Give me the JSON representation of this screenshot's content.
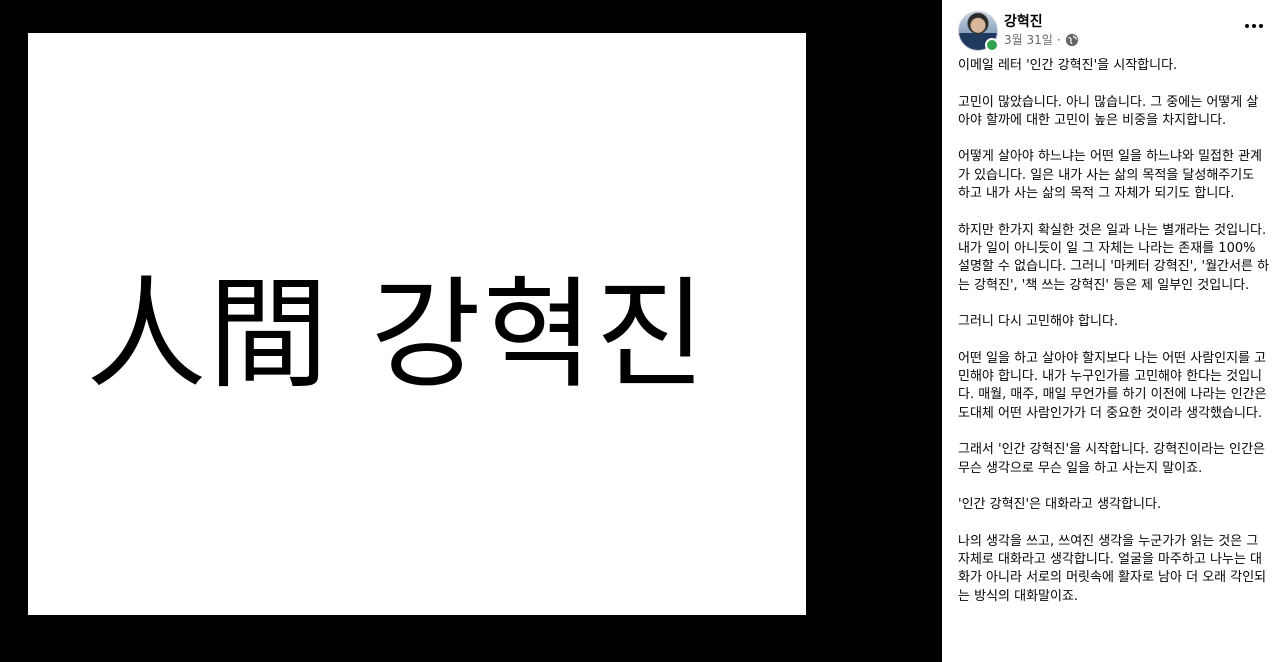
{
  "photo": {
    "text": "人間 강혁진"
  },
  "post": {
    "author": "강혁진",
    "date": "3월 31일",
    "separator": "·",
    "privacy_icon": "globe-icon",
    "more_icon": "more-dots-icon",
    "paragraphs": [
      "이메일 레터 '인간 강혁진'을 시작합니다.",
      "고민이 많았습니다. 아니 많습니다. 그 중에는 어떻게 살아야 할까에 대한 고민이 높은 비중을 차지합니다.",
      "어떻게 살아야 하느냐는 어떤 일을 하느냐와 밀접한 관계가 있습니다. 일은 내가 사는 삶의 목적을 달성해주기도 하고 내가 사는 삶의 목적 그 자체가 되기도 합니다.",
      "하지만 한가지 확실한 것은 일과 나는 별개라는 것입니다. 내가 일이 아니듯이 일 그 자체는 나라는 존재를 100% 설명할 수 없습니다. 그러니 '마케터 강혁진', '월간서른 하는 강혁진', '책 쓰는 강혁진' 등은 제 일부인 것입니다.",
      "그러니 다시 고민해야 합니다.",
      "어떤 일을 하고 살아야 할지보다 나는 어떤 사람인지를 고민해야 합니다. 내가 누구인가를 고민해야 한다는 것입니다. 매월, 매주, 매일 무언가를 하기 이전에 나라는 인간은 도대체 어떤 사람인가가 더 중요한 것이라 생각했습니다.",
      "그래서 '인간 강혁진'을 시작합니다. 강혁진이라는 인간은 무슨 생각으로 무슨 일을 하고 사는지 말이죠.",
      "'인간 강혁진'은 대화라고 생각합니다.",
      "나의 생각을 쓰고, 쓰여진 생각을 누군가가 읽는 것은 그 자체로 대화라고 생각합니다. 얼굴을 마주하고 나누는 대화가 아니라 서로의 머릿속에 활자로 남아 더 오래 각인되는 방식의 대화말이죠."
    ]
  },
  "colors": {
    "online": "#31a24c",
    "secondary_text": "#65676b"
  }
}
